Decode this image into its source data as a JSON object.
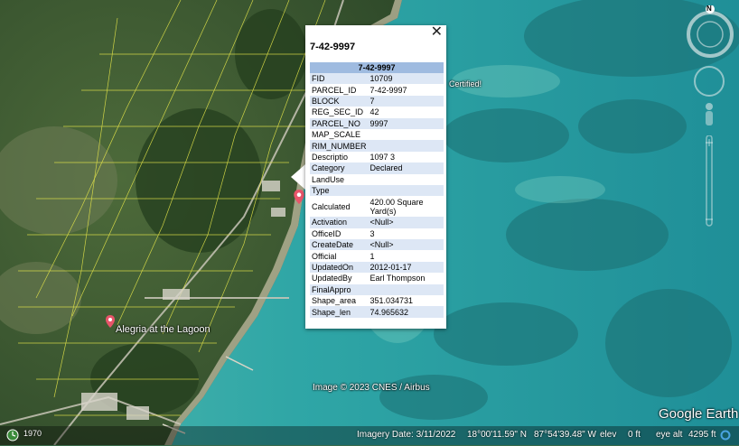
{
  "map": {
    "places": [
      {
        "name": "Alegria at the Lagoon"
      }
    ],
    "partial_label": "Certified!",
    "attribution": "Image © 2023 CNES / Airbus",
    "brand": "Google Earth"
  },
  "compass": {
    "north_label": "N"
  },
  "popup": {
    "title": "7-42-9997",
    "table_header": "7-42-9997",
    "rows": [
      {
        "key": "FID",
        "value": "10709"
      },
      {
        "key": "PARCEL_ID",
        "value": "7-42-9997"
      },
      {
        "key": "BLOCK",
        "value": "7"
      },
      {
        "key": "REG_SEC_ID",
        "value": "42"
      },
      {
        "key": "PARCEL_NO",
        "value": "9997"
      },
      {
        "key": "MAP_SCALE",
        "value": ""
      },
      {
        "key": "RIM_NUMBER",
        "value": ""
      },
      {
        "key": "Descriptio",
        "value": "1097 3"
      },
      {
        "key": "Category",
        "value": "Declared"
      },
      {
        "key": "LandUse",
        "value": ""
      },
      {
        "key": "Type",
        "value": ""
      },
      {
        "key": "Calculated",
        "value": "420.00 Square Yard(s)"
      },
      {
        "key": "Activation",
        "value": "<Null>"
      },
      {
        "key": "OfficeID",
        "value": "3"
      },
      {
        "key": "CreateDate",
        "value": "<Null>"
      },
      {
        "key": "Official",
        "value": "1"
      },
      {
        "key": "UpdatedOn",
        "value": "2012-01-17"
      },
      {
        "key": "UpdatedBy",
        "value": "Earl Thompson"
      },
      {
        "key": "FinalAppro",
        "value": ""
      },
      {
        "key": "Shape_area",
        "value": "351.034731"
      },
      {
        "key": "Shape_len",
        "value": "74.965632"
      }
    ]
  },
  "status": {
    "year": "1970",
    "imagery_date": "Imagery Date: 3/11/2022",
    "lat": "18°00'11.59\" N",
    "lon": "87°54'39.48\" W",
    "elev_label": "elev",
    "elev_value": "0 ft",
    "eye_alt_label": "eye alt",
    "eye_alt_value": "4295 ft"
  },
  "colors": {
    "water": "#2aa3a8",
    "deep_water": "#1e7f8c",
    "land": "#3e5e2f",
    "parcel_line": "#e8e84a",
    "popup_header": "#9fbbe0",
    "pin": "#e8556a"
  }
}
